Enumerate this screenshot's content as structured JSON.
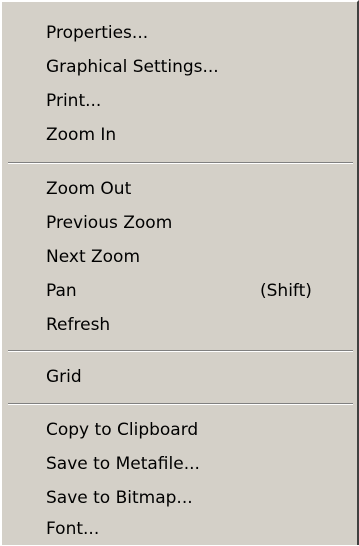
{
  "menu": {
    "items": [
      {
        "label": "Properties..."
      },
      {
        "label": "Graphical Settings..."
      },
      {
        "label": "Print..."
      },
      {
        "label": "Zoom In"
      },
      {
        "label": "Zoom Out"
      },
      {
        "label": "Previous Zoom"
      },
      {
        "label": "Next Zoom"
      },
      {
        "label": "Pan",
        "shortcut": "(Shift)"
      },
      {
        "label": "Refresh"
      },
      {
        "label": "Grid"
      },
      {
        "label": "Copy to Clipboard"
      },
      {
        "label": "Save to Metafile..."
      },
      {
        "label": "Save to Bitmap..."
      },
      {
        "label": "Font..."
      }
    ]
  },
  "colors": {
    "menu_background": "#d4d0c8",
    "text": "#000000",
    "separator_shadow": "#808080",
    "separator_highlight": "#ffffff"
  }
}
